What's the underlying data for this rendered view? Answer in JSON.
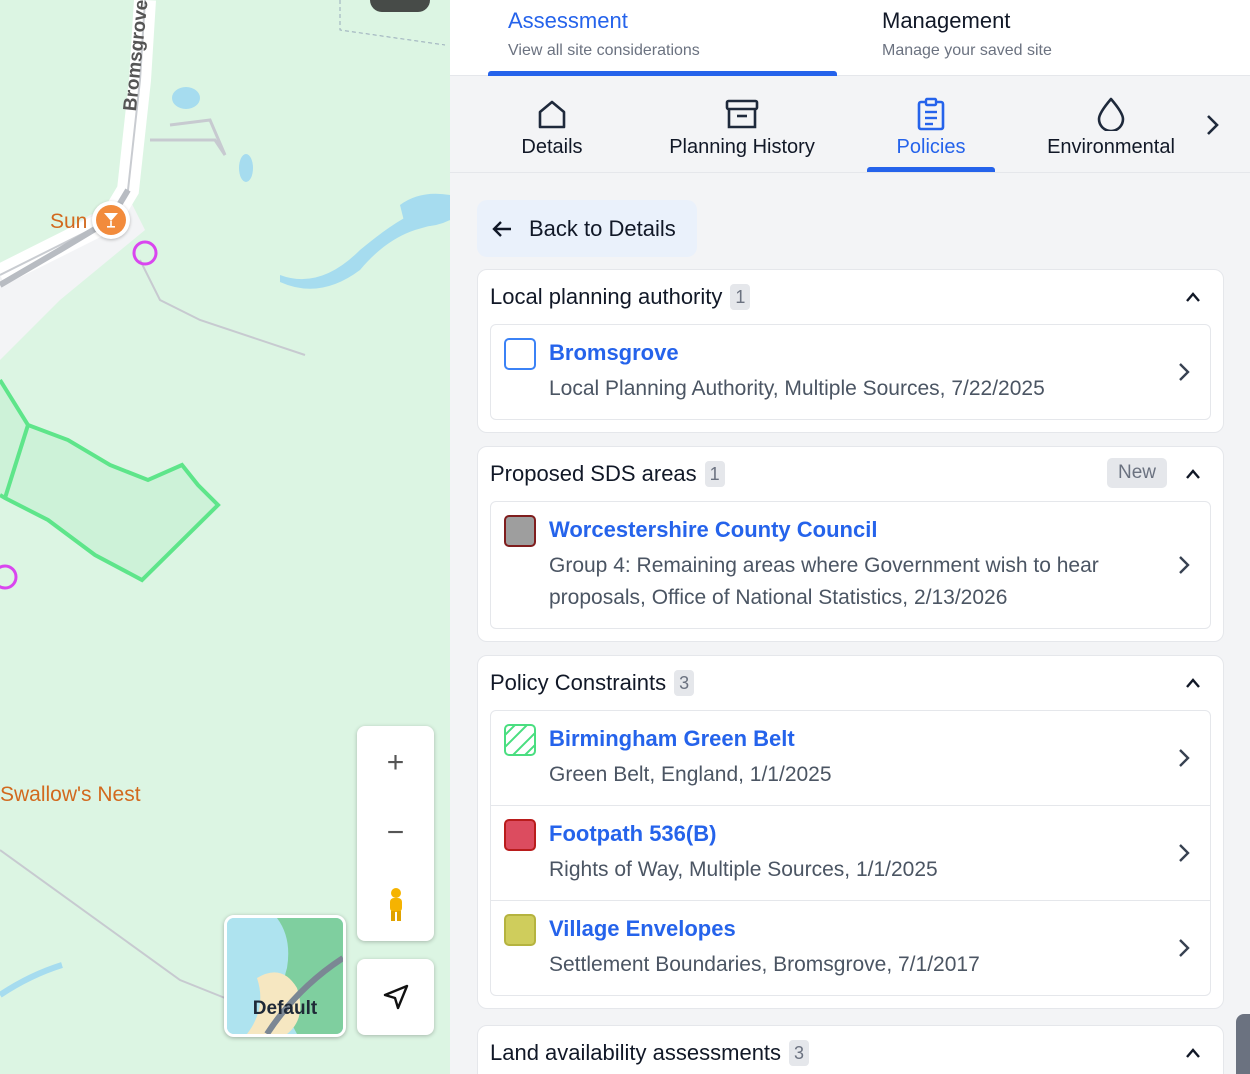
{
  "map": {
    "labels": {
      "sun": "Sun",
      "swallows_nest": "Swallow's Nest",
      "road": "Bromsgrove"
    },
    "controls": {
      "zoom_in": "+",
      "zoom_out": "−"
    },
    "style_thumb_label": "Default"
  },
  "top_tabs": [
    {
      "title": "Assessment",
      "subtitle": "View all site considerations"
    },
    {
      "title": "Management",
      "subtitle": "Manage your saved site"
    }
  ],
  "icon_tabs": [
    {
      "label": "Details",
      "icon": "home-icon"
    },
    {
      "label": "Planning History",
      "icon": "archive-icon"
    },
    {
      "label": "Policies",
      "icon": "clipboard-icon"
    },
    {
      "label": "Environmental",
      "icon": "droplet-icon"
    }
  ],
  "back_button": "Back to Details",
  "sections": [
    {
      "title": "Local planning authority",
      "count": "1",
      "items": [
        {
          "title": "Bromsgrove",
          "subtitle": "Local Planning Authority, Multiple Sources, 7/22/2025",
          "swatch": "#ffffff",
          "swatch_border": "#3b82f6"
        }
      ]
    },
    {
      "title": "Proposed SDS areas",
      "count": "1",
      "badge": "New",
      "items": [
        {
          "title": "Worcestershire County Council",
          "subtitle": "Group 4: Remaining areas where Government wish to hear proposals, Office of National Statistics, 2/13/2026",
          "swatch": "#9e9e9e",
          "swatch_border": "#7f1d1d"
        }
      ]
    },
    {
      "title": "Policy Constraints",
      "count": "3",
      "items": [
        {
          "title": "Birmingham Green Belt",
          "subtitle": "Green Belt, England, 1/1/2025",
          "swatch": "hatch",
          "swatch_border": "#4ade80"
        },
        {
          "title": "Footpath 536(B)",
          "subtitle": "Rights of Way, Multiple Sources, 1/1/2025",
          "swatch": "#dc4c5f",
          "swatch_border": "#b91c1c"
        },
        {
          "title": "Village Envelopes",
          "subtitle": "Settlement Boundaries, Bromsgrove, 7/1/2017",
          "swatch": "#cfcd5c",
          "swatch_border": "#b5b33f"
        }
      ]
    },
    {
      "title": "Land availability assessments",
      "count": "3",
      "items": []
    }
  ],
  "colors": {
    "accent": "#2563eb",
    "map_green": "#dcf5e3",
    "boundary_green": "#5ee58a"
  }
}
